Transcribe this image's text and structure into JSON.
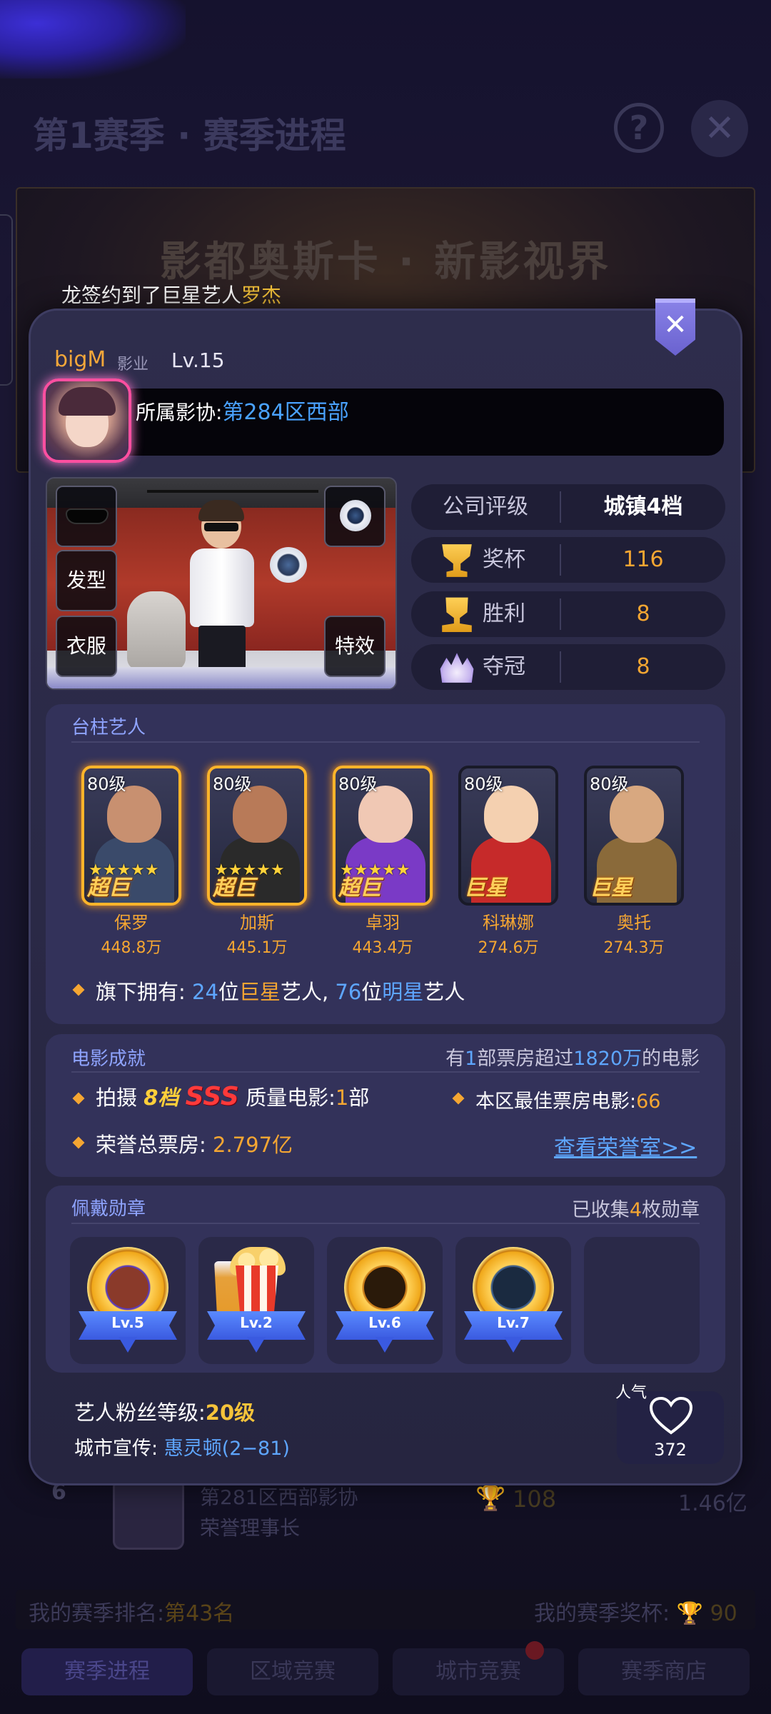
{
  "background": {
    "title": "第1赛季 · 赛季进程",
    "help_icon": "?",
    "close_icon": "✕",
    "banner_title": "影都奥斯卡 · 新影视界",
    "row": {
      "rank": "6",
      "name": "第281区西部影协",
      "sub": "荣誉理事长",
      "trophies": "108",
      "box": "1.46亿"
    },
    "my_rank_label": "我的赛季排名:",
    "my_rank_value": "第43名",
    "my_reward_label": "我的赛季奖杯:",
    "my_reward_value": "90",
    "tabs": [
      "赛季进程",
      "区域竞赛",
      "城市竞赛",
      "赛季商店"
    ]
  },
  "toast": {
    "prefix": "龙签约到了巨星艺人",
    "highlight": "罗杰"
  },
  "profile": {
    "name": "bigM",
    "company": "影业",
    "level": "Lv.15",
    "guild_label": "所属影协:",
    "guild_value": "第284区西部"
  },
  "room": {
    "slot_hair": "发型",
    "slot_clothes": "衣服",
    "slot_effect": "特效"
  },
  "stats": {
    "rating_label": "公司评级",
    "rating_value": "城镇4档",
    "trophy_label": "奖杯",
    "trophy_value": "116",
    "win_label": "胜利",
    "win_value": "8",
    "champion_label": "夺冠",
    "champion_value": "8"
  },
  "pillar": {
    "title": "台柱艺人",
    "artists": [
      {
        "level": "80级",
        "stars": "★★★★★",
        "rank": "超巨",
        "name": "保罗",
        "fans": "448.8万",
        "skin": "#c89070",
        "outfit": "#3a4a6a"
      },
      {
        "level": "80级",
        "stars": "★★★★★",
        "rank": "超巨",
        "name": "加斯",
        "fans": "445.1万",
        "skin": "#b87a58",
        "outfit": "#2a2a2a"
      },
      {
        "level": "80级",
        "stars": "★★★★★",
        "rank": "超巨",
        "name": "卓羽",
        "fans": "443.4万",
        "skin": "#f0c8b4",
        "outfit": "#7a3ac6"
      },
      {
        "level": "80级",
        "stars": "",
        "rank": "巨星",
        "name": "科琳娜",
        "fans": "274.6万",
        "skin": "#f4d0b0",
        "outfit": "#c62a2a"
      },
      {
        "level": "80级",
        "stars": "",
        "rank": "巨星",
        "name": "奥托",
        "fans": "274.3万",
        "skin": "#d8a880",
        "outfit": "#8a6a3a"
      }
    ],
    "summary_prefix": "旗下拥有:",
    "summary_superstar_count": "24",
    "summary_superstar_word": "位",
    "summary_superstar_label": "巨星",
    "summary_mid": "艺人,",
    "summary_star_count": "76",
    "summary_star_word": "位",
    "summary_star_label": "明星",
    "summary_suffix": "艺人"
  },
  "film": {
    "title": "电影成就",
    "right_prefix": "有",
    "right_count": "1",
    "right_mid": "部票房超过",
    "right_amount": "1820万",
    "right_suffix": "的电影",
    "shoot_prefix": "拍摄",
    "shoot_tier": "8档",
    "shoot_grade": "SSS",
    "shoot_mid": "质量电影:",
    "shoot_count": "1",
    "shoot_suffix": "部",
    "best_label": "本区最佳票房电影:",
    "best_value": "66",
    "honor_label": "荣誉总票房:",
    "honor_value": "2.797亿",
    "hall_link": "查看荣誉室>>"
  },
  "medals": {
    "title": "佩戴勋章",
    "right_prefix": "已收集",
    "right_count": "4",
    "right_suffix": "枚勋章",
    "items": [
      "Lv.5",
      "Lv.2",
      "Lv.6",
      "Lv.7"
    ]
  },
  "footer": {
    "fan_label": "艺人粉丝等级:",
    "fan_value": "20级",
    "city_label": "城市宣传:",
    "city_value": "惠灵顿(2−81)",
    "pop_label": "人气",
    "pop_value": "372"
  }
}
